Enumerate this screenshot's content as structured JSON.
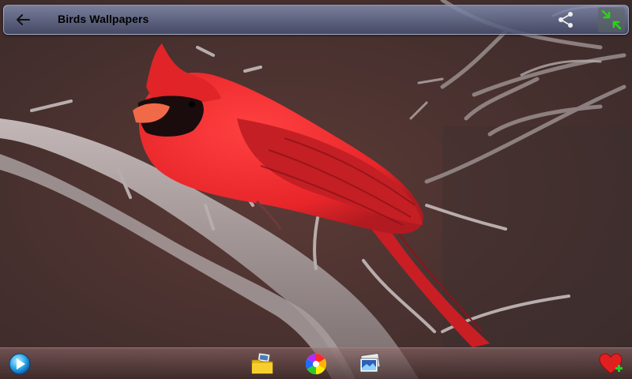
{
  "app": {
    "title": "Birds Wallpapers"
  },
  "topbar": {
    "back_icon": "arrow-left-icon",
    "share_icon": "share-icon",
    "fullscreen_icon": "fullscreen-toggle-icon"
  },
  "wallpaper": {
    "subject": "red cardinal bird on branch",
    "colors": {
      "background": "#4a2a28",
      "bird_red": "#e8262a",
      "mask_black": "#1a0c0c",
      "beak": "#f06a4a",
      "branch": "#a59a9a"
    }
  },
  "bottombar": {
    "icons": [
      "play-globe-icon",
      "folder-icon",
      "color-wheel-icon",
      "gallery-icon",
      "favorite-add-icon"
    ]
  }
}
